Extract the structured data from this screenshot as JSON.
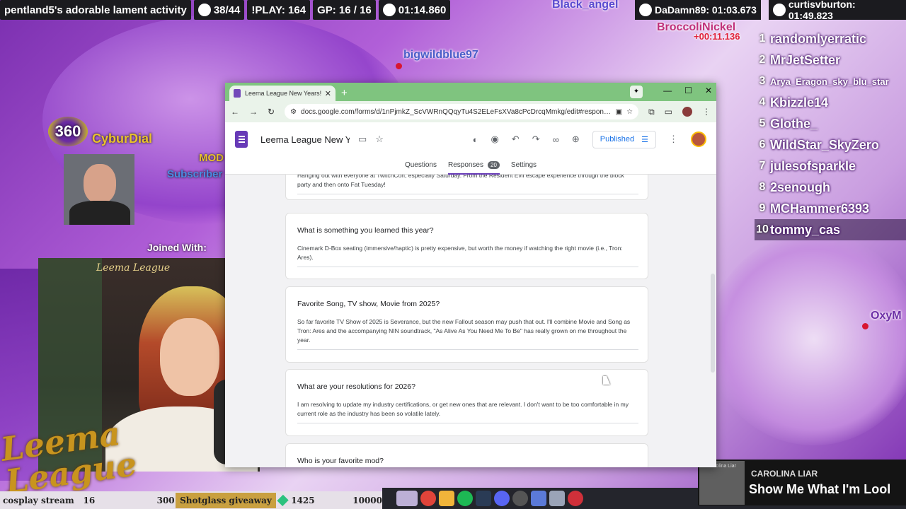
{
  "stream": {
    "game_title": "pentland5's adorable lament activity",
    "counter": "38/44",
    "play_count": "!PLAY: 164",
    "gp": "GP: 16 / 16",
    "timer": "01:14.860",
    "top_times": [
      {
        "name": "DaDamn89: 01:03.673"
      },
      {
        "name": "curtisvburton: 01:49.823"
      }
    ],
    "map_names": [
      "Black_angel",
      "BroccoliNickel",
      "+00:11.136",
      "bigwildblue97",
      "OxyM"
    ],
    "leaderboard": [
      {
        "rank": "1",
        "name": "randomlyerratic"
      },
      {
        "rank": "2",
        "name": "MrJetSetter"
      },
      {
        "rank": "3",
        "name": "Arya_Eragon_sky_blu_star"
      },
      {
        "rank": "4",
        "name": "Kbizzle14"
      },
      {
        "rank": "5",
        "name": "Glothe_"
      },
      {
        "rank": "6",
        "name": "WildStar_SkyZero"
      },
      {
        "rank": "7",
        "name": "julesofsparkle"
      },
      {
        "rank": "8",
        "name": "2senough"
      },
      {
        "rank": "9",
        "name": "MCHammer6393"
      },
      {
        "rank": "10",
        "name": "tommy_cas"
      }
    ],
    "viewer_level": "360",
    "viewer_name": "CyburDial",
    "mod_label": "MOD",
    "subscriber_label": "Subscriber",
    "joined_with": "Joined With:",
    "cam_caption": "Leema League",
    "logo_line1": "Leema",
    "logo_line2": "League",
    "ticker": {
      "left": "cosplay stream",
      "num1": "16",
      "num2": "300",
      "giveaway": "Shotglass giveaway",
      "gems": "1425",
      "num3": "10000"
    },
    "now_playing": {
      "art_text": "Carolina Liar",
      "artist": "CAROLINA LIAR",
      "song": "Show Me What I'm Lool"
    }
  },
  "browser": {
    "tab_title": "Leema League New Years! - Go",
    "url": "docs.google.com/forms/d/1nPjmkZ_ScVWRnQQqyTu4S2ELeFsXVa8cPcDrcqMmkg/edit#respons..."
  },
  "form": {
    "title": "Leema League New Yea",
    "publish_label": "Published",
    "tabs": {
      "questions": "Questions",
      "responses": "Responses",
      "responses_count": "20",
      "settings": "Settings"
    },
    "cards": [
      {
        "question": "",
        "answer": "Hanging out with everyone at TwitchCon, especially Saturday. From the Resident Evil escape experience through the block party and then onto Fat Tuesday!"
      },
      {
        "question": "What is something you learned this year?",
        "answer": "Cinemark D-Box seating (immersive/haptic) is pretty expensive, but worth the money if watching the right movie (i.e., Tron: Ares)."
      },
      {
        "question": "Favorite Song, TV show, Movie from 2025?",
        "answer": "So far favorite TV Show of 2025 is Severance, but the new Fallout season may push that out.  I'll combine Movie and Song as Tron: Ares and the accompanying NIN soundtrack, \"As Alive As You Need Me To Be\" has really grown on me throughout the year."
      },
      {
        "question": "What are your resolutions for 2026?",
        "answer": "I am resolving to update my industry certifications, or get new ones that are relevant.  I don't want to be too comfortable in my current role as the industry has been so volatile lately."
      },
      {
        "question": "Who is your favorite mod?",
        "answer": ""
      }
    ]
  }
}
